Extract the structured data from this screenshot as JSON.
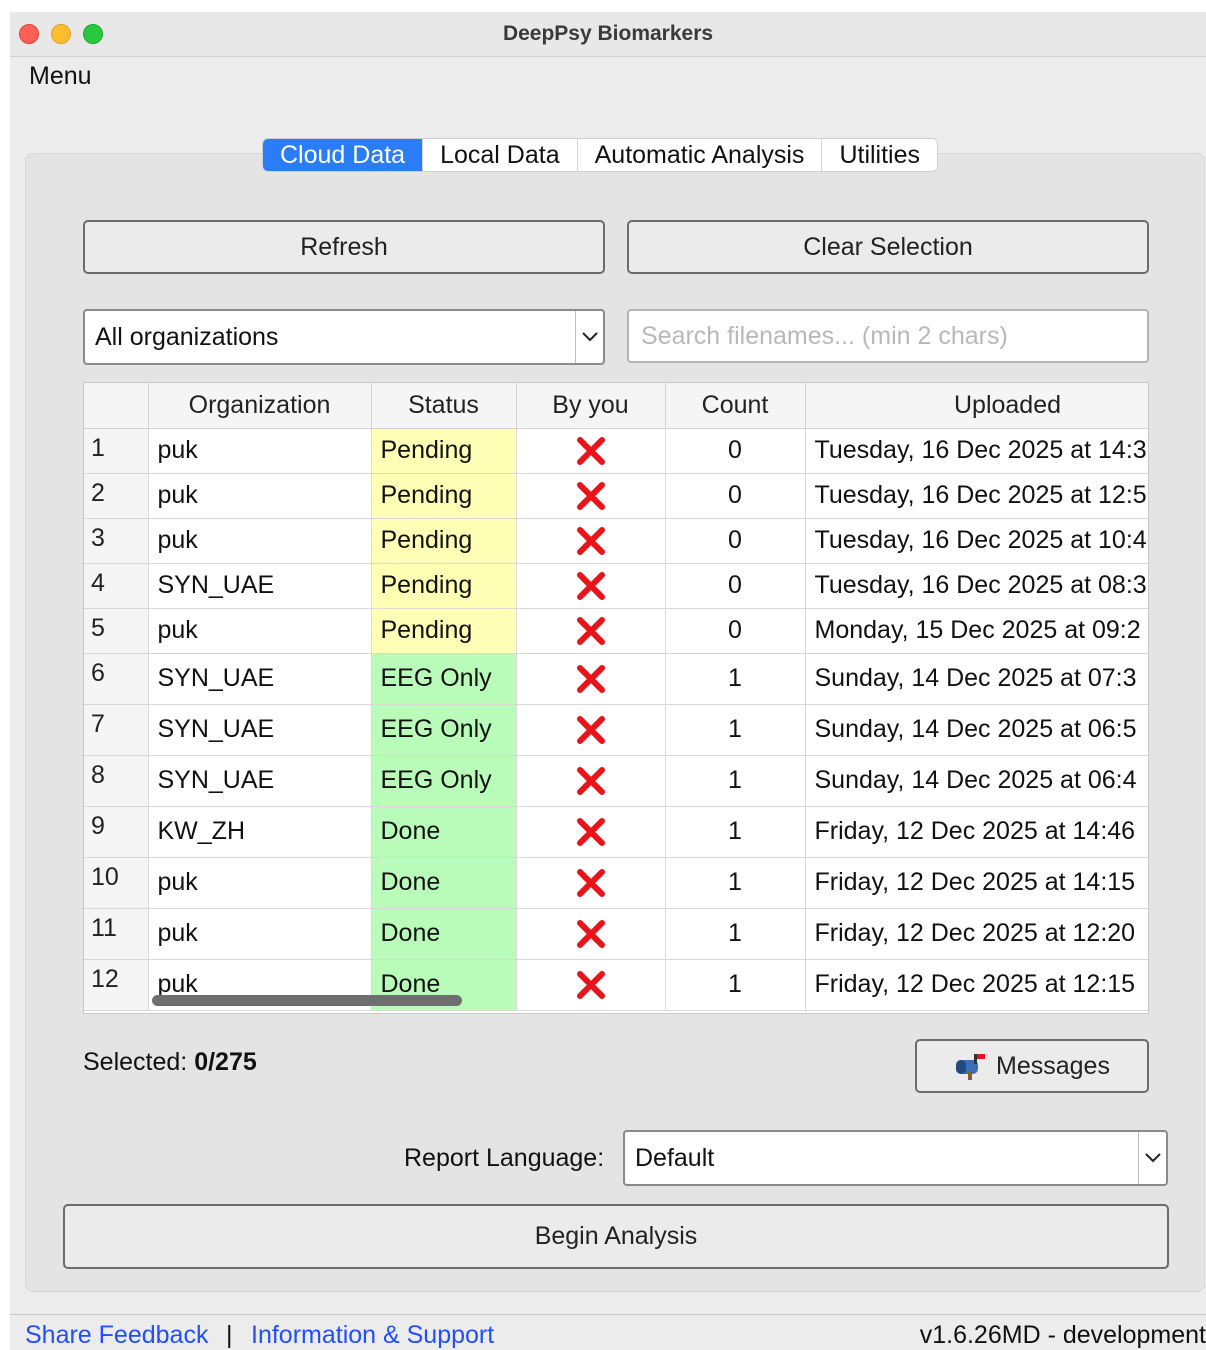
{
  "window": {
    "title": "DeepPsy Biomarkers"
  },
  "menubar": {
    "menu_label": "Menu"
  },
  "tabs": [
    {
      "label": "Cloud Data",
      "active": true
    },
    {
      "label": "Local Data",
      "active": false
    },
    {
      "label": "Automatic Analysis",
      "active": false
    },
    {
      "label": "Utilities",
      "active": false
    }
  ],
  "toolbar": {
    "refresh_label": "Refresh",
    "clear_label": "Clear Selection"
  },
  "filters": {
    "organization_selected": "All organizations",
    "search_placeholder": "Search filenames... (min 2 chars)"
  },
  "table": {
    "columns": [
      "",
      "Organization",
      "Status",
      "By you",
      "Count",
      "Uploaded"
    ],
    "rows": [
      {
        "num": "1",
        "organization": "puk",
        "status": "Pending",
        "by_you": "no",
        "count": "0",
        "uploaded": "Tuesday, 16 Dec 2025 at 14:3"
      },
      {
        "num": "2",
        "organization": "puk",
        "status": "Pending",
        "by_you": "no",
        "count": "0",
        "uploaded": "Tuesday, 16 Dec 2025 at 12:5"
      },
      {
        "num": "3",
        "organization": "puk",
        "status": "Pending",
        "by_you": "no",
        "count": "0",
        "uploaded": "Tuesday, 16 Dec 2025 at 10:4"
      },
      {
        "num": "4",
        "organization": "SYN_UAE",
        "status": "Pending",
        "by_you": "no",
        "count": "0",
        "uploaded": "Tuesday, 16 Dec 2025 at 08:3"
      },
      {
        "num": "5",
        "organization": "puk",
        "status": "Pending",
        "by_you": "no",
        "count": "0",
        "uploaded": "Monday, 15 Dec 2025 at 09:2"
      },
      {
        "num": "6",
        "organization": "SYN_UAE",
        "status": "EEG Only",
        "by_you": "no",
        "count": "1",
        "uploaded": "Sunday, 14 Dec 2025 at 07:3"
      },
      {
        "num": "7",
        "organization": "SYN_UAE",
        "status": "EEG Only",
        "by_you": "no",
        "count": "1",
        "uploaded": "Sunday, 14 Dec 2025 at 06:5"
      },
      {
        "num": "8",
        "organization": "SYN_UAE",
        "status": "EEG Only",
        "by_you": "no",
        "count": "1",
        "uploaded": "Sunday, 14 Dec 2025 at 06:4"
      },
      {
        "num": "9",
        "organization": "KW_ZH",
        "status": "Done",
        "by_you": "no",
        "count": "1",
        "uploaded": "Friday, 12 Dec 2025 at 14:46"
      },
      {
        "num": "10",
        "organization": "puk",
        "status": "Done",
        "by_you": "no",
        "count": "1",
        "uploaded": "Friday, 12 Dec 2025 at 14:15"
      },
      {
        "num": "11",
        "organization": "puk",
        "status": "Done",
        "by_you": "no",
        "count": "1",
        "uploaded": "Friday, 12 Dec 2025 at 12:20"
      },
      {
        "num": "12",
        "organization": "puk",
        "status": "Done",
        "by_you": "no",
        "count": "1",
        "uploaded": "Friday, 12 Dec 2025 at 12:15"
      }
    ]
  },
  "selection": {
    "label": "Selected:",
    "value": "0/275"
  },
  "messages": {
    "label": "Messages",
    "icon": "mailbox-icon"
  },
  "report_language": {
    "label": "Report Language:",
    "selected": "Default"
  },
  "actions": {
    "begin_label": "Begin Analysis"
  },
  "footer": {
    "feedback_label": "Share Feedback",
    "separator": "|",
    "info_label": "Information & Support",
    "version": "v1.6.26MD - development"
  },
  "colors": {
    "accent": "#2a7df6",
    "pending_bg": "#ffffb6",
    "done_bg": "#b9fbb9",
    "x_red": "#e8141a",
    "link": "#1f4fff"
  }
}
